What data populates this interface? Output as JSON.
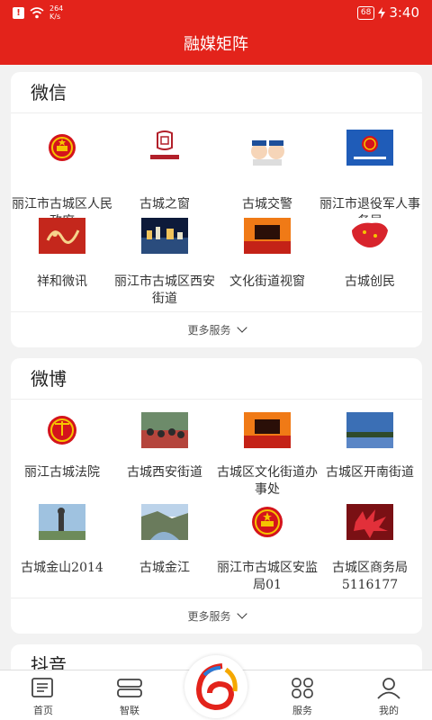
{
  "status_bar": {
    "speed_value": "264",
    "speed_unit": "K/s",
    "battery": "68",
    "time": "3:40"
  },
  "header": {
    "title": "融媒矩阵"
  },
  "wechat": {
    "title": "微信",
    "items": [
      {
        "name": "丽江市古城区人民政府",
        "icon": "national-emblem-icon"
      },
      {
        "name": "古城之窗",
        "icon": "gucheng-window-logo-icon"
      },
      {
        "name": "古城交警",
        "icon": "traffic-police-icon"
      },
      {
        "name": "丽江市退役军人事务局",
        "icon": "veterans-affairs-emblem-icon"
      },
      {
        "name": "祥和微讯",
        "icon": "xianghe-calligraphy-icon"
      },
      {
        "name": "丽江市古城区西安街道",
        "icon": "night-city-photo-icon"
      },
      {
        "name": "文化街道视窗",
        "icon": "culture-street-logo-icon"
      },
      {
        "name": "古城创民",
        "icon": "china-map-icon"
      }
    ],
    "more_label": "更多服务"
  },
  "weibo": {
    "title": "微博",
    "items": [
      {
        "name": "丽江古城法院",
        "icon": "court-emblem-icon"
      },
      {
        "name": "古城西安街道",
        "icon": "crowd-photo-icon"
      },
      {
        "name": "古城区文化街道办事处",
        "icon": "culture-street-logo-icon"
      },
      {
        "name": "古城区开南街道",
        "icon": "lake-landscape-icon"
      },
      {
        "name": "古城金山2014",
        "icon": "statue-photo-icon"
      },
      {
        "name": "古城金江",
        "icon": "river-valley-photo-icon"
      },
      {
        "name": "丽江市古城区安监局01",
        "icon": "national-emblem-icon"
      },
      {
        "name": "古城区商务局5116177",
        "icon": "red-leaves-photo-icon"
      }
    ],
    "more_label": "更多服务"
  },
  "douyin": {
    "title": "抖音"
  },
  "tabbar": {
    "tabs": [
      {
        "label": "首页",
        "icon": "home-newspaper-icon"
      },
      {
        "label": "智联",
        "icon": "smart-connect-icon"
      },
      {
        "label": "服务",
        "icon": "services-grid-icon"
      },
      {
        "label": "我的",
        "icon": "user-profile-icon"
      }
    ],
    "center_logo": "app-logo-icon"
  },
  "colors": {
    "brand_red": "#e3231b"
  }
}
